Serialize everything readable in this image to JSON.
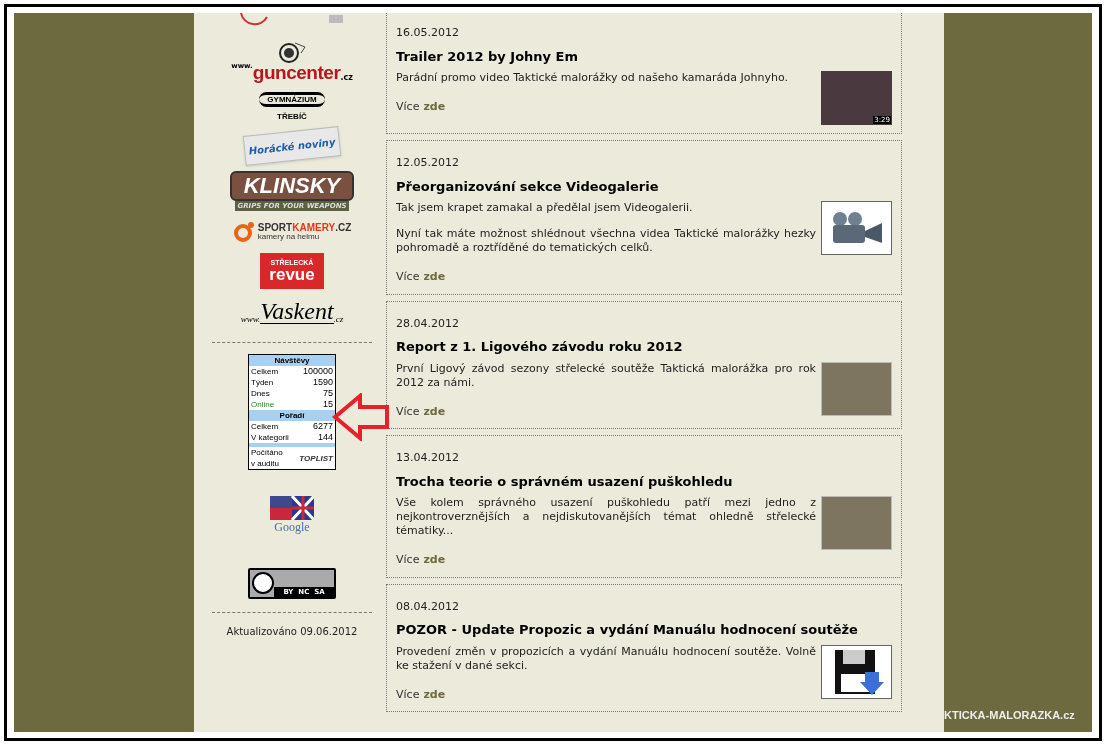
{
  "sponsors": [
    {
      "kind": "emblem"
    },
    {
      "kind": "guncenter",
      "texts": [
        "www.",
        "guncenter",
        ".cz"
      ]
    },
    {
      "kind": "gymnazium",
      "texts": [
        "GYMNÁZIUM",
        "TŘEBÍČ"
      ]
    },
    {
      "kind": "newspaper",
      "texts": [
        "Horácké noviny"
      ]
    },
    {
      "kind": "klinsky",
      "texts": [
        "KLINSKY",
        "GRIPS FOR YOUR WEAPONS"
      ]
    },
    {
      "kind": "sportkamery",
      "texts": [
        "SPORT",
        "KAMERY",
        ".CZ",
        "kamery na helmu"
      ]
    },
    {
      "kind": "revue",
      "texts": [
        "STŘELECKÁ",
        "revue"
      ]
    },
    {
      "kind": "vaskent",
      "texts": [
        "www.",
        "Vaskent",
        ".cz"
      ]
    }
  ],
  "counter": {
    "sections": [
      {
        "title": "Návštěvy",
        "rows": [
          {
            "label": "Celkem",
            "value": "100000",
            "online": false
          },
          {
            "label": "Týden",
            "value": "1590",
            "online": false
          },
          {
            "label": "Dnes",
            "value": "75",
            "online": false
          },
          {
            "label": "Online",
            "value": "15",
            "online": true
          }
        ]
      },
      {
        "title": "Pořadí",
        "rows": [
          {
            "label": "Celkem",
            "value": "6277",
            "online": false
          },
          {
            "label": "V kategorii",
            "value": "144",
            "online": false
          }
        ]
      }
    ],
    "audit": [
      "Počítáno",
      "v auditu"
    ],
    "logo": "TOPLIST"
  },
  "translate": {
    "label": "Google"
  },
  "license": {
    "label": "BY  NC  SA"
  },
  "updated": "Aktualizováno 09.06.2012",
  "posts": [
    {
      "date": "16.05.2012",
      "title": "Trailer 2012 by Johny Em",
      "paragraphs": [
        "Parádní promo video Taktické malorážky od našeho kamaráda Johnyho."
      ],
      "more": "Více",
      "link": "zde",
      "thumb": {
        "kind": "video",
        "badge": "3:29"
      }
    },
    {
      "date": "12.05.2012",
      "title": "Přeorganizování sekce Videogalerie",
      "paragraphs": [
        "Tak jsem krapet zamakal a předělal jsem Videogalerii.",
        "Nyní tak máte možnost shlédnout všechna videa Taktické malorážky hezky pohromadě a roztříděné do tematických celků."
      ],
      "more": "Více",
      "link": "zde",
      "thumb": {
        "kind": "camera"
      }
    },
    {
      "date": "28.04.2012",
      "title": "Report z 1. Ligového závodu roku 2012",
      "paragraphs": [
        "První Ligový závod sezony střelecké soutěže Taktická malorážka pro rok 2012 za námi."
      ],
      "more": "Více",
      "link": "zde",
      "thumb": {
        "kind": "photo"
      }
    },
    {
      "date": "13.04.2012",
      "title": "Trocha teorie o správném usazení puškohledu",
      "paragraphs": [
        "Vše kolem správného usazení puškohledu patří mezi jedno z nejkontroverznějších a nejdiskutovanějších témat ohledně střelecké tématiky..."
      ],
      "more": "Více",
      "link": "zde",
      "thumb": {
        "kind": "photo"
      }
    },
    {
      "date": "08.04.2012",
      "title": "POZOR - Update Propozic a vydání Manuálu hodnocení soutěže",
      "paragraphs": [
        "Provedení změn v propozicích a vydání Manuálu hodnocení soutěže. Volně ke stažení v dané sekci."
      ],
      "more": "Více",
      "link": "zde",
      "thumb": {
        "kind": "download"
      }
    }
  ],
  "site_banner": "KTICKA-MALORAZKA.cz"
}
